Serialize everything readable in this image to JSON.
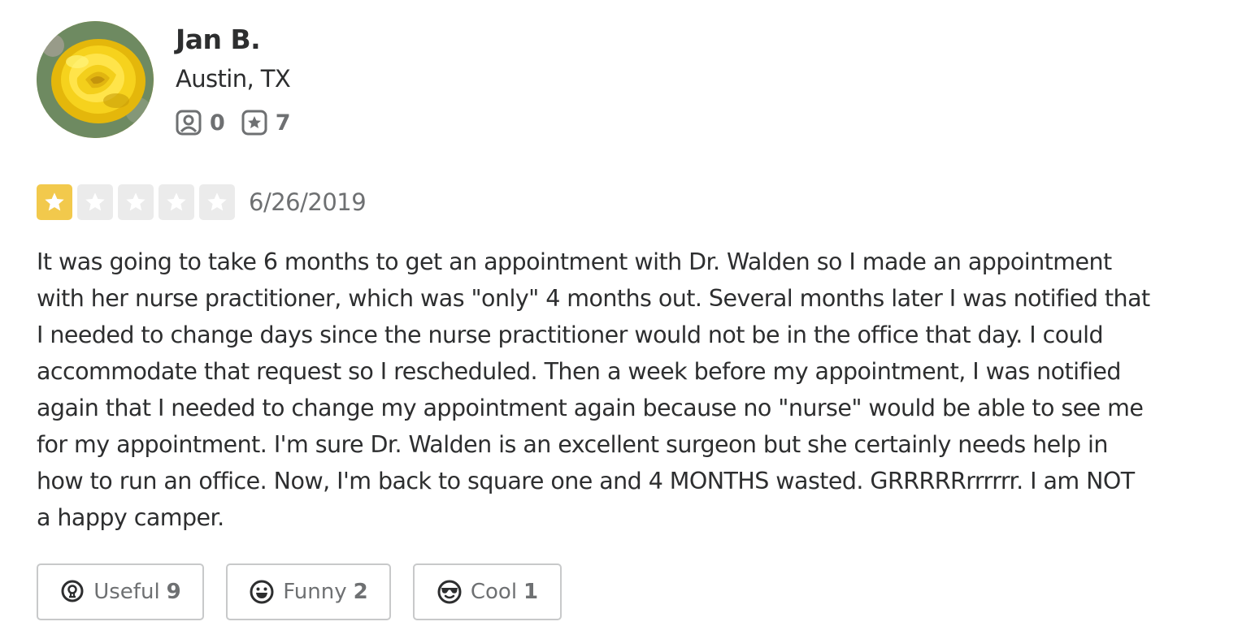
{
  "user": {
    "name": "Jan B.",
    "location": "Austin, TX",
    "friends_count": "0",
    "reviews_count": "7",
    "avatar_icon": "yellow-rose-photo"
  },
  "review": {
    "rating": 1,
    "rating_max": 5,
    "date": "6/26/2019",
    "text": "It was going to take 6 months to get an appointment with Dr. Walden so I made an appointment\nwith her nurse practitioner, which was \"only\" 4 months out.  Several months later I was notified that\nI needed to change days since the nurse practitioner would not be in the office that day.  I could\naccommodate that request so I rescheduled. Then a week before my appointment, I was notified\nagain that I needed to change my appointment again because no \"nurse\" would be able to see me\nfor my appointment.  I'm sure Dr. Walden is an excellent surgeon but she certainly needs help in\nhow to run an office.  Now, I'm back to square one and 4 MONTHS wasted.  GRRRRRrrrrrr.  I am NOT\na happy camper."
  },
  "reactions": {
    "useful": {
      "label": "Useful",
      "count": "9",
      "icon": "lightbulb-icon"
    },
    "funny": {
      "label": "Funny",
      "count": "2",
      "icon": "smiley-icon"
    },
    "cool": {
      "label": "Cool",
      "count": "1",
      "icon": "sunglasses-icon"
    }
  },
  "colors": {
    "star_active": "#f2c94c",
    "star_inactive": "#ebebeb",
    "text": "#2d2e2f",
    "muted": "#6e7072",
    "button_border": "#c8c9ca"
  }
}
